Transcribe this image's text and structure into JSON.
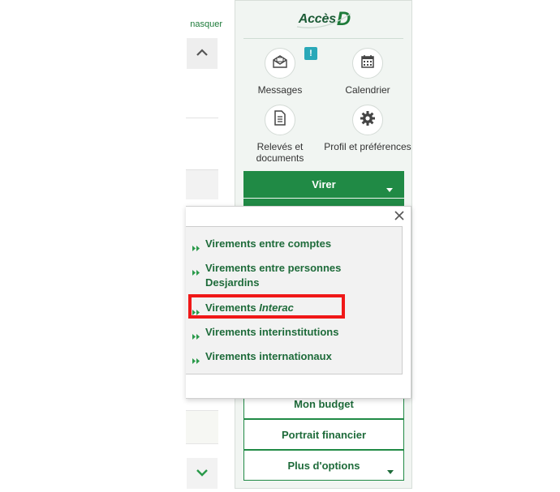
{
  "colors": {
    "brand_green": "#208a45",
    "link_green": "#1e6b3a",
    "panel_bg": "#f1f5f2",
    "highlight_red": "#f01818",
    "badge_teal": "#2aa8b8"
  },
  "left": {
    "hide_link": "nasquer",
    "scroll_up_icon": "chevron-up-icon",
    "scroll_down_icon": "chevron-down-icon"
  },
  "panel": {
    "logo_text": "Accès",
    "logo_letter": "D",
    "shortcuts": [
      {
        "label": "Messages",
        "icon": "envelope-icon",
        "badge": "!"
      },
      {
        "label": "Calendrier",
        "icon": "calendar-icon"
      },
      {
        "label": "Relevés et documents",
        "icon": "document-icon"
      },
      {
        "label": "Profil et préférences",
        "icon": "gear-icon"
      }
    ],
    "primary_button": "Virer",
    "buttons": [
      "Mon budget",
      "Portrait financier",
      "Plus d'options"
    ]
  },
  "popup": {
    "close_icon": "close-icon",
    "items": [
      {
        "label": "Virements entre comptes"
      },
      {
        "label": "Virements entre personnes Desjardins"
      },
      {
        "label_prefix": "Virements ",
        "label_emphasis": "Interac",
        "highlighted": true
      },
      {
        "label": "Virements interinstitutions"
      },
      {
        "label": "Virements internationaux"
      }
    ]
  }
}
